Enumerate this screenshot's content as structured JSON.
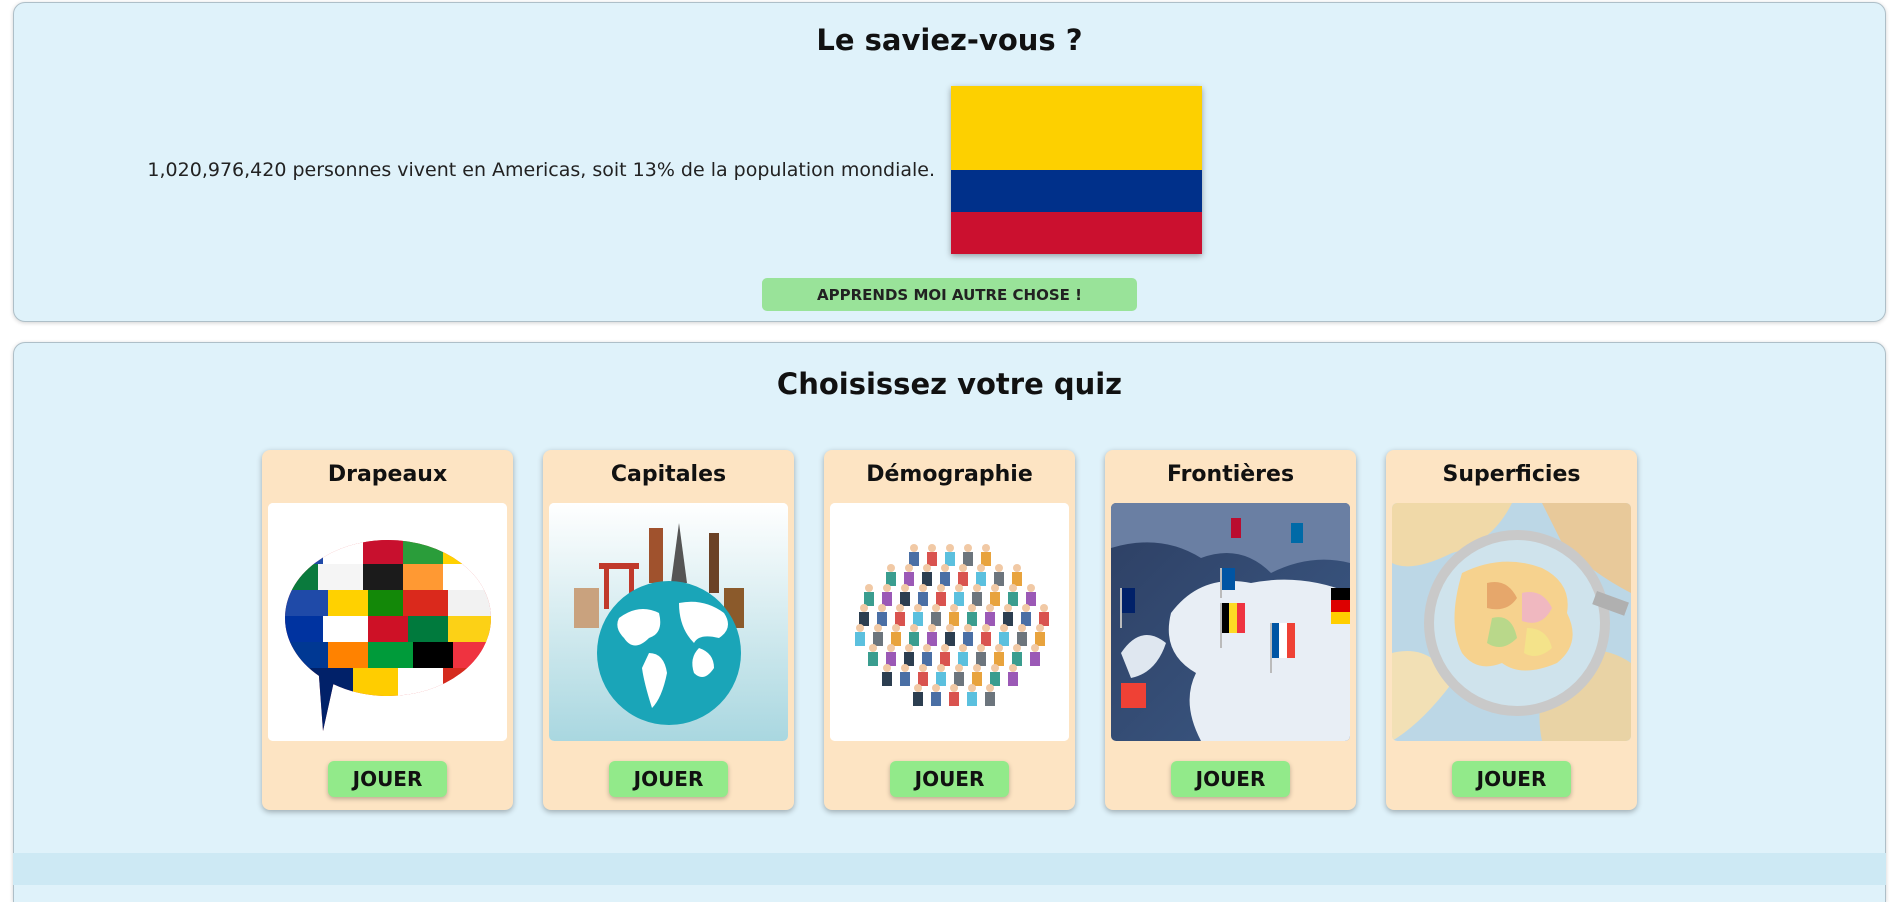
{
  "fact": {
    "title": "Le saviez-vous ?",
    "text": "1,020,976,420 personnes vivent en Americas, soit 13% de la population mondiale.",
    "flag_colors": [
      "#fdd000",
      "#00308a",
      "#cb102f"
    ],
    "learn_more_label": "APPRENDS MOI AUTRE CHOSE !"
  },
  "quiz": {
    "title": "Choisissez votre quiz",
    "cards": [
      {
        "title": "Drapeaux",
        "image": "flags-speech-bubble-illustration",
        "play_label": "JOUER"
      },
      {
        "title": "Capitales",
        "image": "globe-with-landmarks-illustration",
        "play_label": "JOUER"
      },
      {
        "title": "Démographie",
        "image": "crowd-of-people-illustration",
        "play_label": "JOUER"
      },
      {
        "title": "Frontières",
        "image": "map-with-flag-pins-photo",
        "play_label": "JOUER"
      },
      {
        "title": "Superficies",
        "image": "magnifying-glass-over-map-photo",
        "play_label": "JOUER"
      }
    ]
  },
  "colors": {
    "panel_background": "#dff2fa",
    "card_background": "#fde4c3",
    "button_green": "#92ea8a"
  }
}
